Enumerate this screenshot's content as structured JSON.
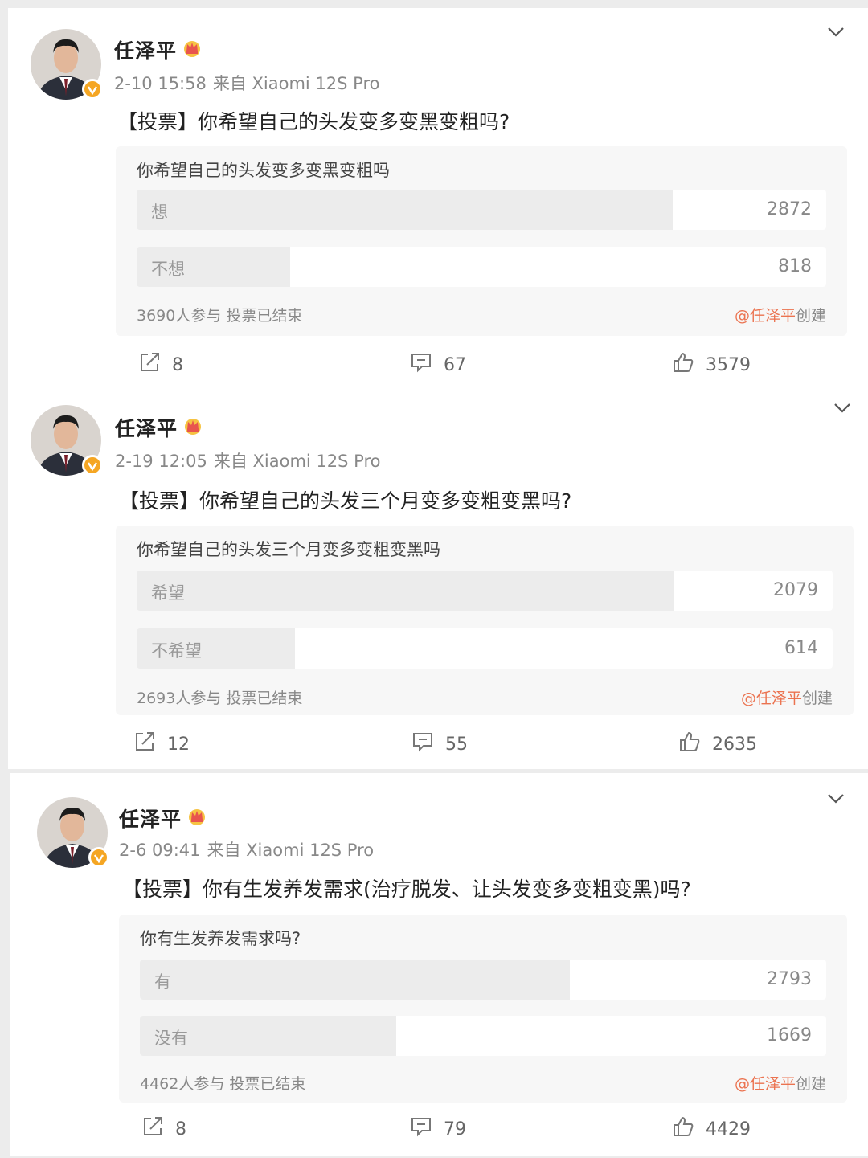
{
  "posts": [
    {
      "author": "任泽平",
      "time": "2-10 15:58",
      "source": "来自 Xiaomi 12S Pro",
      "title": "【投票】你希望自己的头发变多变黑变粗吗?",
      "poll": {
        "question": "你希望自己的头发变多变黑变粗吗",
        "options": [
          {
            "label": "想",
            "count": "2872",
            "share": 0.777
          },
          {
            "label": "不想",
            "count": "818",
            "share": 0.223
          }
        ],
        "participants": "3690人参与",
        "status": "投票已结束",
        "creator_at": "@任泽平",
        "creator_suffix": "创建"
      },
      "reposts": "8",
      "comments": "67",
      "likes": "3579"
    },
    {
      "author": "任泽平",
      "time": "2-19 12:05",
      "source": "来自 Xiaomi 12S Pro",
      "title": "【投票】你希望自己的头发三个月变多变粗变黑吗?",
      "poll": {
        "question": "你希望自己的头发三个月变多变粗变黑吗",
        "options": [
          {
            "label": "希望",
            "count": "2079",
            "share": 0.772
          },
          {
            "label": "不希望",
            "count": "614",
            "share": 0.228
          }
        ],
        "participants": "2693人参与",
        "status": "投票已结束",
        "creator_at": "@任泽平",
        "creator_suffix": "创建"
      },
      "reposts": "12",
      "comments": "55",
      "likes": "2635"
    },
    {
      "author": "任泽平",
      "time": "2-6 09:41",
      "source": "来自 Xiaomi 12S Pro",
      "title": "【投票】你有生发养发需求(治疗脱发、让头发变多变粗变黑)吗?",
      "poll": {
        "question": "你有生发养发需求吗?",
        "options": [
          {
            "label": "有",
            "count": "2793",
            "share": 0.626
          },
          {
            "label": "没有",
            "count": "1669",
            "share": 0.374
          }
        ],
        "participants": "4462人参与",
        "status": "投票已结束",
        "creator_at": "@任泽平",
        "creator_suffix": "创建"
      },
      "reposts": "8",
      "comments": "79",
      "likes": "4429"
    }
  ],
  "icons": {
    "repost": "share-square-icon",
    "comment": "comment-bubble-icon",
    "like": "thumbs-up-icon",
    "menu": "chevron-down-icon",
    "vip": "crown-icon",
    "verified": "verified-badge-icon"
  },
  "colors": {
    "creator_link": "#eb7350",
    "verified_badge": "#f5a623"
  }
}
